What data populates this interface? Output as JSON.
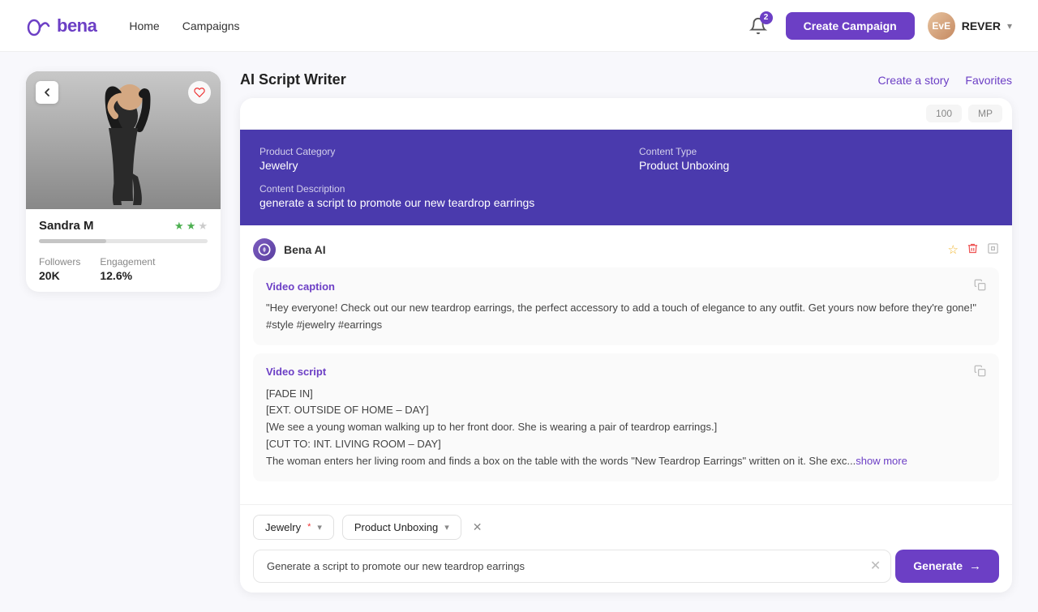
{
  "app": {
    "logo_text": "bena",
    "nav_links": [
      "Home",
      "Campaigns"
    ],
    "create_campaign_label": "Create Campaign",
    "notifications_count": "2",
    "user_initials": "EvE",
    "user_name": "REVER"
  },
  "profile": {
    "name": "Sandra M",
    "followers_label": "Followers",
    "followers_value": "20K",
    "engagement_label": "Engagement",
    "engagement_value": "12.6%",
    "stars": [
      true,
      true,
      false
    ]
  },
  "script_writer": {
    "title": "AI Script Writer",
    "create_story_label": "Create a story",
    "favorites_label": "Favorites",
    "top_bar": {
      "btn1": "100",
      "btn2": "MP"
    },
    "info_box": {
      "product_category_label": "Product Category",
      "product_category_value": "Jewelry",
      "content_type_label": "Content Type",
      "content_type_value": "Product Unboxing",
      "content_description_label": "Content Description",
      "content_description_value": "generate a script to promote our new teardrop earrings"
    },
    "ai_sender_name": "Bena AI",
    "video_caption": {
      "label": "Video caption",
      "text": "\"Hey everyone! Check out our new teardrop earrings, the perfect accessory to add a touch of elegance to any outfit. Get yours now before they're gone!\" #style #jewelry #earrings"
    },
    "video_script": {
      "label": "Video script",
      "text": "[FADE IN]\n[EXT. OUTSIDE OF HOME – DAY]\n[We see a young woman walking up to her front door. She is wearing a pair of teardrop earrings.]\n[CUT TO: INT. LIVING ROOM – DAY]\nThe woman enters her living room and finds a box on the table with the words \"New Teardrop Earrings\" written on it. She exc...",
      "show_more": "show more"
    },
    "bottom": {
      "category_label": "Jewelry",
      "category_required": "*",
      "content_type_label": "Product Unboxing",
      "input_placeholder": "Generate a script to promote our new teardrop earrings",
      "generate_label": "Generate"
    }
  }
}
